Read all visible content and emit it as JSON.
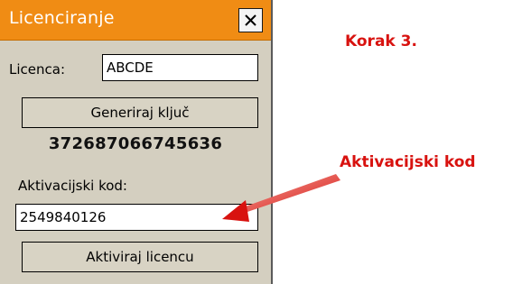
{
  "dialog": {
    "title": "Licenciranje",
    "close_icon": "close-icon",
    "license_label": "Licenca:",
    "license_value": "ABCDE",
    "generate_button": "Generiraj ključ",
    "generated_key": "372687066745636",
    "activation_label": "Aktivacijski kod:",
    "activation_value": "2549840126",
    "activate_button": "Aktiviraj licencu"
  },
  "annotations": {
    "step": "Korak 3.",
    "activation_pointer": "Aktivacijski kod",
    "arrow_icon": "arrow-icon"
  },
  "colors": {
    "titlebar": "#f08c14",
    "dialog_bg": "#d4cfc0",
    "annotation": "#d8120f"
  }
}
